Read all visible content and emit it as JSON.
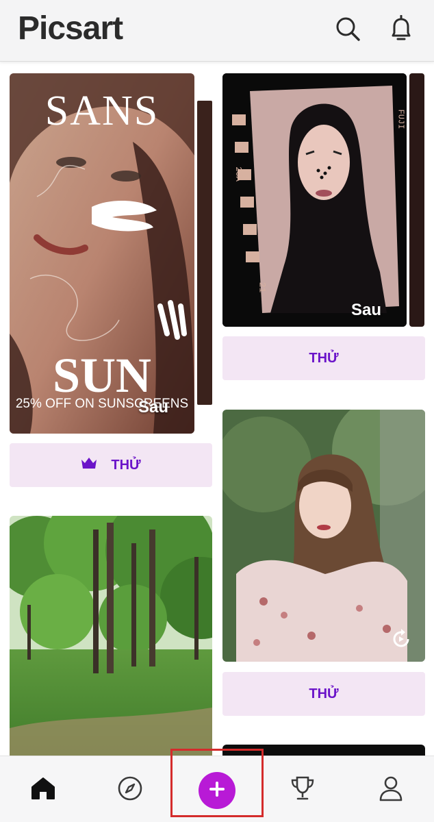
{
  "header": {
    "logo_text": "Picsart",
    "search_icon": "search-icon",
    "notifications_icon": "bell-icon"
  },
  "feed": {
    "cards": [
      {
        "id": "card-sans-sun",
        "overlay_top_text": "SANS",
        "overlay_bottom_text": "SUN",
        "promo_text": "25% OFF ON SUNSCREENS",
        "after_label": "Sau",
        "try_label": "THỬ",
        "premium": true,
        "premium_icon": "crown-icon"
      },
      {
        "id": "card-film",
        "film_text_1": "FUJI",
        "film_text_2": "20A",
        "film_text_3": "21",
        "after_label": "Sau",
        "try_label": "THỬ",
        "premium": false
      },
      {
        "id": "card-forest",
        "try_label": "",
        "premium": false
      },
      {
        "id": "card-girl-video",
        "video_icon": "replay-icon",
        "try_label": "THỬ",
        "premium": false
      }
    ]
  },
  "bottom_nav": {
    "items": [
      {
        "name": "home",
        "icon": "home-icon",
        "active": true
      },
      {
        "name": "discover",
        "icon": "compass-icon",
        "active": false
      },
      {
        "name": "create",
        "icon": "plus-icon",
        "active": false
      },
      {
        "name": "challenges",
        "icon": "trophy-icon",
        "active": false
      },
      {
        "name": "profile",
        "icon": "user-icon",
        "active": false
      }
    ]
  },
  "colors": {
    "accent": "#b81ad6",
    "button_bg": "#f3e6f4",
    "button_text": "#6b14c9",
    "highlight": "#d42b2b"
  }
}
